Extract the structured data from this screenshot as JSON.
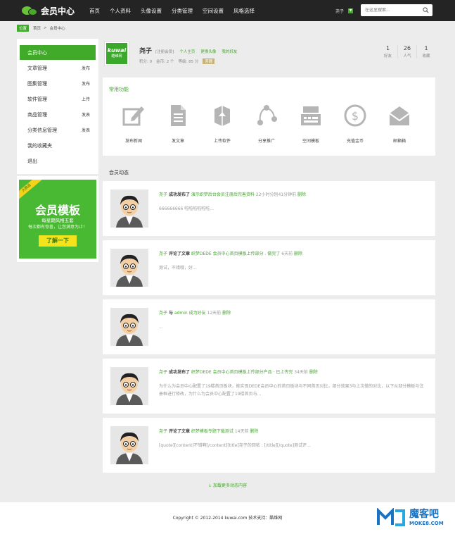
{
  "header": {
    "logo_text": "会员中心",
    "nav": [
      "首页",
      "个人资料",
      "头像设置",
      "分类管理",
      "空间设置",
      "风格选择"
    ],
    "username": "尧子",
    "search_placeholder": "在这里搜索..."
  },
  "breadcrumb": {
    "tag": "位置",
    "items": [
      "首页",
      ">",
      "会员中心"
    ]
  },
  "sidebar": {
    "items": [
      {
        "label": "会员中心",
        "action": ""
      },
      {
        "label": "文章管理",
        "action": "发布"
      },
      {
        "label": "图集管理",
        "action": "发布"
      },
      {
        "label": "软件管理",
        "action": "上传"
      },
      {
        "label": "商品管理",
        "action": "发表"
      },
      {
        "label": "分类信息管理",
        "action": "发表"
      },
      {
        "label": "我的收藏夹",
        "action": ""
      },
      {
        "label": "退出",
        "action": ""
      }
    ]
  },
  "banner": {
    "ribbon": "大放送",
    "title": "会员模板",
    "subtitle": "每星期风格五套",
    "subtitle2": "每次都有惊喜，让您满意为止！",
    "button": "了解一下"
  },
  "profile": {
    "logo_main": "kuwai",
    "logo_sub": "酷维网",
    "name": "尧子",
    "level": "[注册会员]",
    "links": [
      "个人主页",
      "更换头像",
      "我的好友"
    ],
    "meta": [
      "积分: 0",
      "金币: 2 个",
      "等级: 85 分",
      "答题"
    ],
    "stats": [
      {
        "value": "1",
        "label": "好友"
      },
      {
        "value": "26",
        "label": "人气"
      },
      {
        "value": "1",
        "label": "收藏"
      }
    ]
  },
  "functions": {
    "title": "常用功能",
    "items": [
      "发布新闻",
      "发文章",
      "上传软件",
      "分享推广",
      "空间模板",
      "充值金币",
      "邮箱箱"
    ]
  },
  "activity_title": "会员动态",
  "feed": [
    {
      "user": "尧子",
      "verb": "成功发布了",
      "target": "演示织梦后台会员注册后完善资料",
      "time": "22小时分别41分钟前",
      "del": "删除",
      "body": "666666666 啦啦啦啦啦啦..."
    },
    {
      "user": "尧子",
      "verb": "评论了文章",
      "target": "织梦DEDE 会员中心首页模板上传部分 . 做完了",
      "time": "6天前",
      "del": "删除",
      "body": "测试，不错哦，好..."
    },
    {
      "user": "尧子",
      "verb": "与",
      "target": "admin 成为好友",
      "time": "12天前",
      "del": "删除",
      "body": "..."
    },
    {
      "user": "尧子",
      "verb": "成功发布了",
      "target": "织梦DEDE 会员中心首页模板上传部分产品 · 已上传完",
      "time": "34天前",
      "del": "删除",
      "body": "为什么为会员中心配置了19楼首页板块，能实现DEDE会员中心的首页板块与不同首页对比，部分效果3与上次做的对比，以下从部分模板与注册框进行修改，为什么为会员中心配置了19楼首页与..."
    },
    {
      "user": "尧子",
      "verb": "评论了文章",
      "target": "织梦模板专题下载测试",
      "time": "14天前",
      "del": "删除",
      "body": "[quote][content]不错啊[/content][title]尧子的回帖 : [/title][/quote]测试评..."
    }
  ],
  "more": "加载更多动态内容",
  "footer": "Copyright © 2012-2014 kuwai.com 技术支持：酷维网",
  "watermark": {
    "zh": "魔客吧",
    "en": "MOKE8.COM"
  }
}
